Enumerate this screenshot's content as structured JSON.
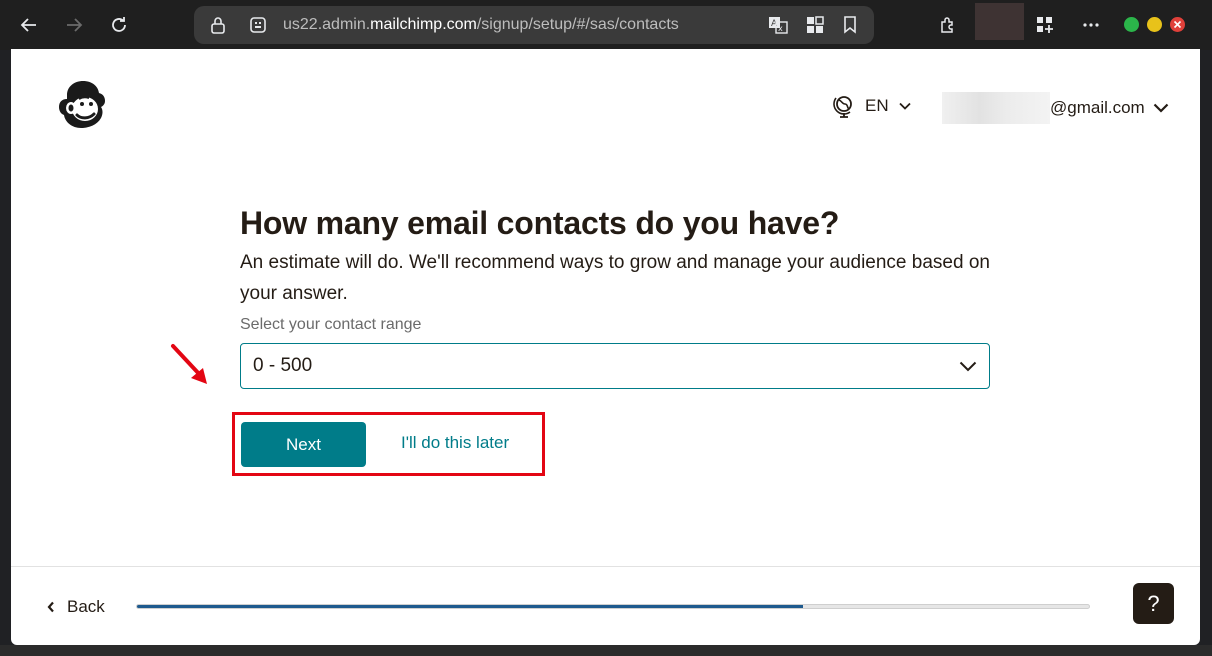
{
  "browser": {
    "url_prefix": "us22.admin.",
    "url_host": "mailchimp.com",
    "url_path": "/signup/setup/#/sas/contacts"
  },
  "header": {
    "language": "EN",
    "account_email_suffix": "@gmail.com"
  },
  "question": {
    "title": "How many email contacts do you have?",
    "subtitle": "An estimate will do. We'll recommend ways to grow and manage your audience based on your answer.",
    "field_label": "Select your contact range",
    "selected_value": "0 - 500"
  },
  "actions": {
    "next_label": "Next",
    "later_label": "I'll do this later"
  },
  "footer": {
    "back_label": "Back",
    "progress": 0.7,
    "help_label": "?"
  },
  "colors": {
    "accent": "#007c89",
    "text": "#241c15",
    "annotation": "#e30613",
    "progress": "#1e5a8e"
  }
}
